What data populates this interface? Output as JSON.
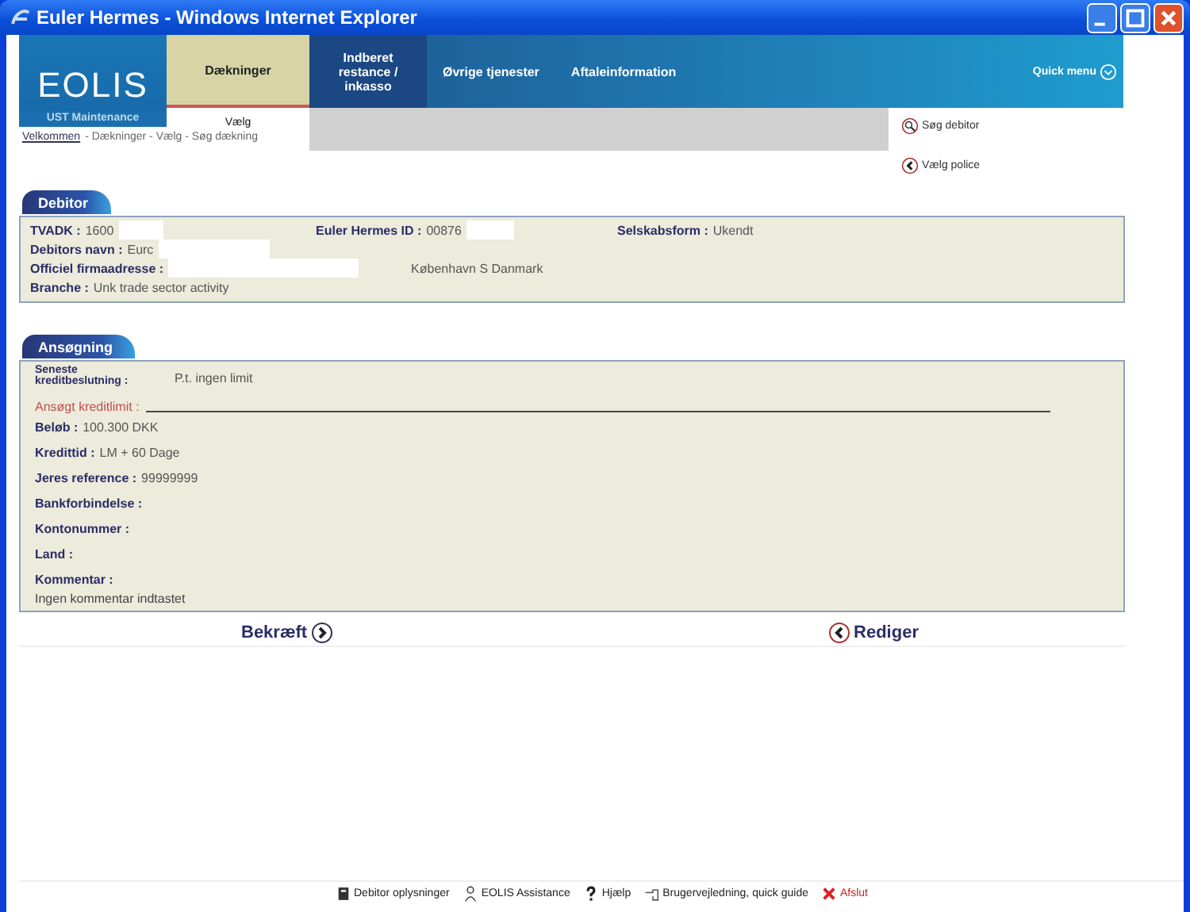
{
  "window": {
    "title": "Euler Hermes - Windows Internet Explorer"
  },
  "logo": {
    "name": "EOLIS",
    "subtitle": "UST Maintenance"
  },
  "nav_tabs": [
    {
      "label": "Dækninger",
      "selected": true
    },
    {
      "label": "Indberet restance / inkasso",
      "selected": false
    },
    {
      "label": "Øvrige tjenester",
      "selected": false
    },
    {
      "label": "Aftaleinformation",
      "selected": false
    }
  ],
  "quick_menu": "Quick menu",
  "sub_nav": [
    {
      "label": "Vælg",
      "selected": true
    }
  ],
  "side_links": [
    {
      "label": "Søg debitor",
      "kind": "search"
    },
    {
      "label": "Vælg police",
      "kind": "back"
    }
  ],
  "breadcrumb": {
    "link": "Velkommen",
    "rest": "- Dækninger - Vælg - Søg dækning"
  },
  "debitor": {
    "title": "Debitor",
    "rows": [
      [
        {
          "label": "TVADK :",
          "parts": [
            {
              "kind": "text",
              "text": "1600"
            },
            {
              "kind": "mask"
            }
          ]
        },
        {
          "label": "Euler Hermes ID :",
          "parts": [
            {
              "kind": "text",
              "text": "00876"
            },
            {
              "kind": "mask"
            }
          ]
        },
        {
          "label": "Selskabsform :",
          "parts": [
            {
              "kind": "text",
              "text": "Ukendt"
            }
          ]
        }
      ],
      [
        {
          "label": "Debitors navn :",
          "parts": [
            {
              "kind": "text",
              "text": "Eurc"
            },
            {
              "kind": "mask"
            }
          ]
        }
      ],
      [
        {
          "label": "Officiel firmaadresse :",
          "parts": [
            {
              "kind": "mask"
            },
            {
              "kind": "text",
              "text": "København S Danmark"
            }
          ]
        }
      ],
      [
        {
          "label": "Branche :",
          "parts": [
            {
              "kind": "text",
              "text": "Unk trade sector activity"
            }
          ]
        }
      ]
    ]
  },
  "ansogning": {
    "title": "Ansøgning",
    "latest": {
      "label": "Seneste kreditbeslutning :",
      "value": "P.t. ingen limit"
    },
    "heading": "Ansøgt kreditlimit :",
    "lines": [
      {
        "label": "Beløb :",
        "value": "100.300 DKK"
      },
      {
        "label": "Kredittid :",
        "value": "LM + 60 Dage"
      },
      {
        "label": "Jeres reference :",
        "value": "99999999"
      },
      {
        "label": "Bankforbindelse :"
      },
      {
        "label": "Kontonummer :"
      },
      {
        "label": "Land :"
      },
      {
        "label": "Kommentar :"
      }
    ],
    "comment": "Ingen kommentar indtastet"
  },
  "actions": [
    {
      "label": "Bekræft",
      "kind": "next"
    },
    {
      "label": "Rediger",
      "kind": "back"
    }
  ],
  "footer_links": [
    {
      "label": "Debitor oplysninger",
      "kind": "info"
    },
    {
      "label": "EOLIS Assistance",
      "kind": "person"
    },
    {
      "label": "Hjælp",
      "kind": "help"
    },
    {
      "label": "Brugervejledning, quick guide",
      "kind": "guide"
    },
    {
      "label": "Afslut",
      "kind": "exit"
    }
  ]
}
